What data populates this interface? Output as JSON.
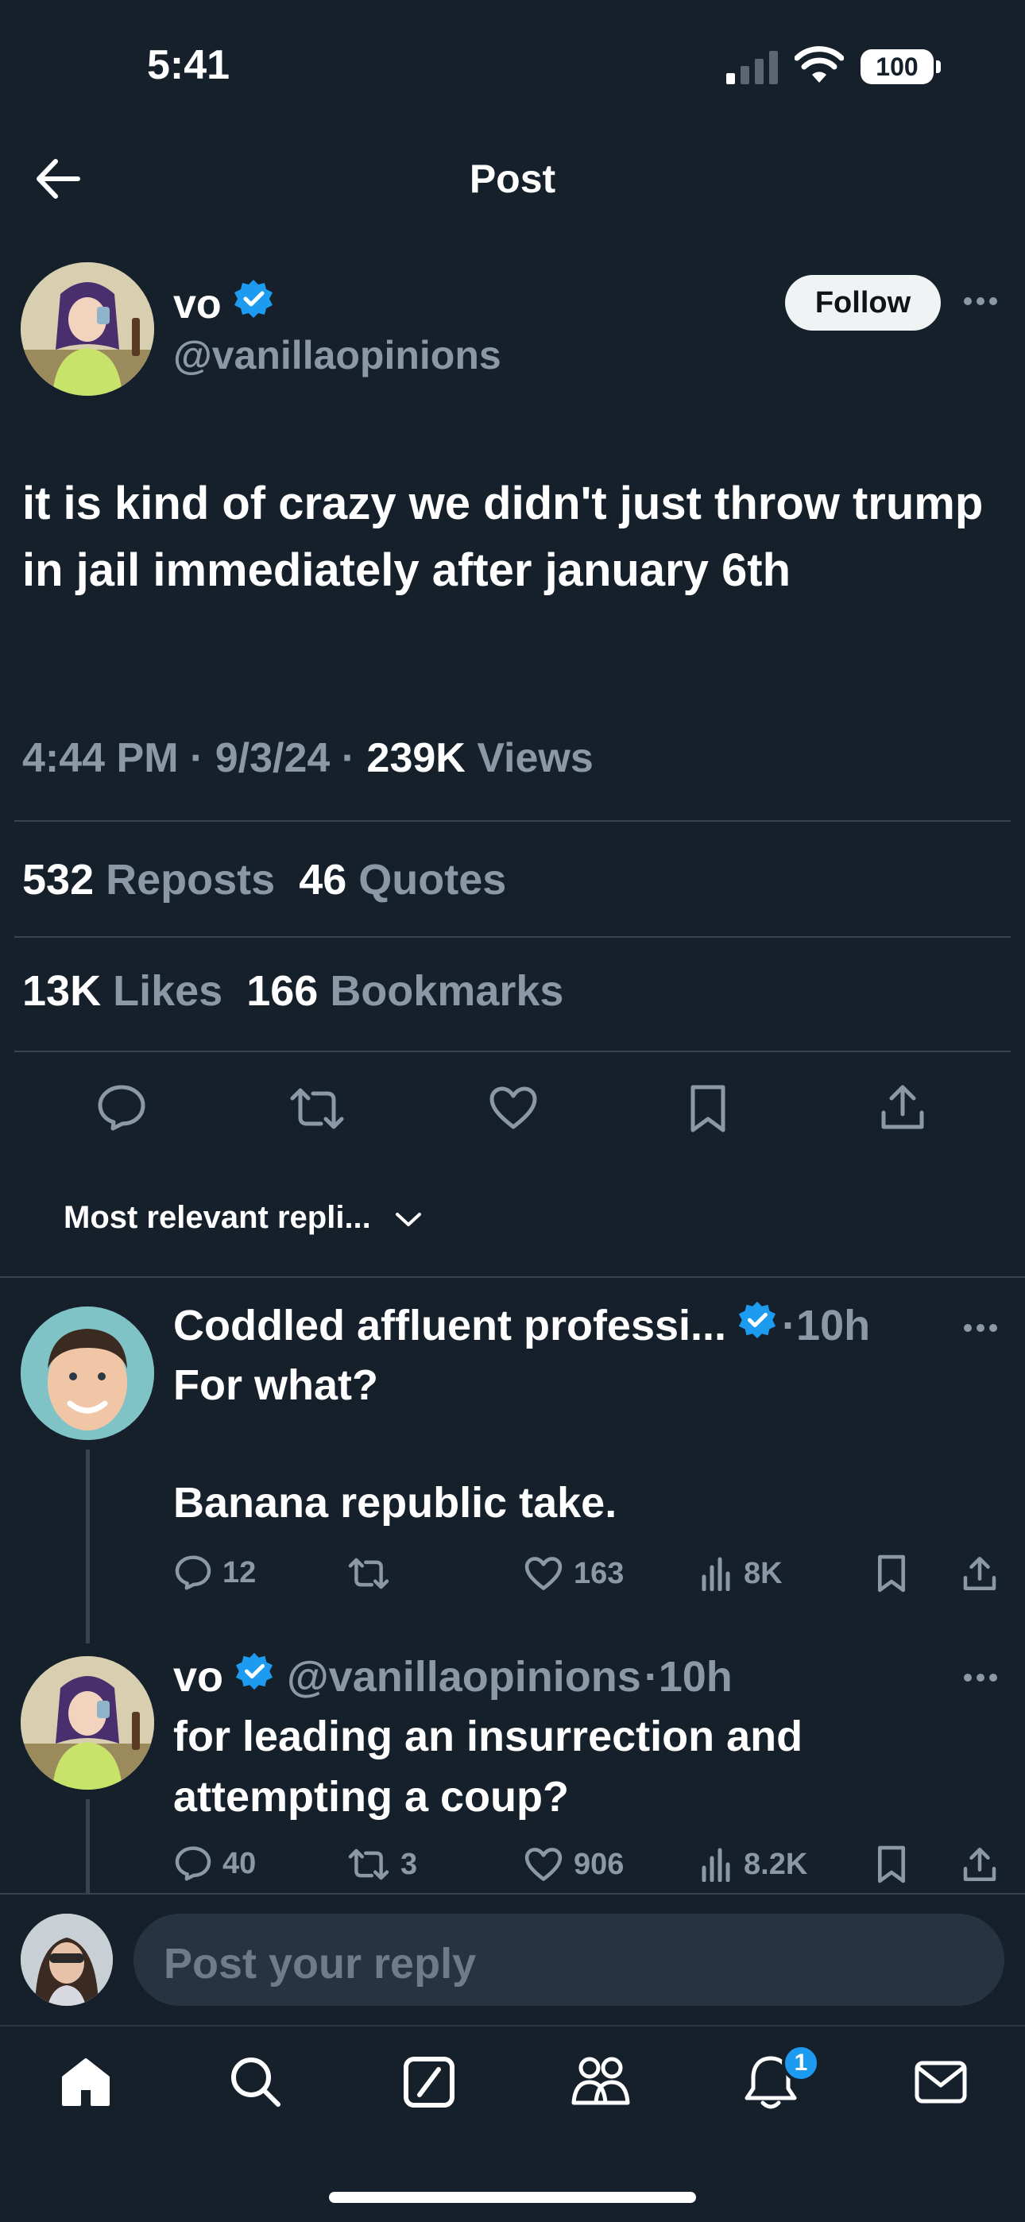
{
  "status_bar": {
    "time": "5:41",
    "battery": "100"
  },
  "header": {
    "title": "Post"
  },
  "post": {
    "author_name": "vo",
    "author_handle": "@vanillaopinions",
    "follow_label": "Follow",
    "text": "it is kind of crazy we didn't just throw trump in jail immediately after january 6th",
    "time": "4:44 PM",
    "date": "9/3/24",
    "views_count": "239K",
    "views_label": "Views",
    "reposts_count": "532",
    "reposts_label": "Reposts",
    "quotes_count": "46",
    "quotes_label": "Quotes",
    "likes_count": "13K",
    "likes_label": "Likes",
    "bookmarks_count": "166",
    "bookmarks_label": "Bookmarks"
  },
  "sort": {
    "label": "Most relevant repli..."
  },
  "replies": [
    {
      "name": "Coddled affluent professi...",
      "time": "10h",
      "line1": "For what?",
      "line2": "Banana republic take.",
      "replies": "12",
      "reposts": "",
      "likes": "163",
      "views": "8K"
    },
    {
      "name": "vo",
      "handle": "@vanillaopinions",
      "time": "10h",
      "line1": "for leading an insurrection and",
      "line2": "attempting a coup?",
      "replies": "40",
      "reposts": "3",
      "likes": "906",
      "views": "8.2K"
    }
  ],
  "composer": {
    "placeholder": "Post your reply"
  },
  "tabbar": {
    "notifications_badge": "1"
  },
  "colors": {
    "background": "#15202b",
    "accent": "#1d9bf0",
    "muted": "#8b98a5",
    "divider": "#38444d"
  }
}
